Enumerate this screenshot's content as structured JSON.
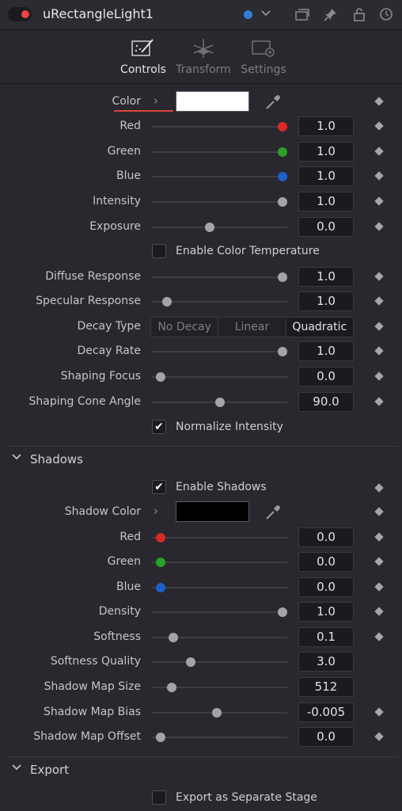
{
  "header": {
    "title": "uRectangleLight1",
    "accent_color": "#2f7fd0",
    "icons": [
      "power-toggle",
      "color-dropdown",
      "versions-icon",
      "pin-icon",
      "lock-icon",
      "reset-icon"
    ]
  },
  "tabs": [
    {
      "label": "Controls",
      "icon": "controls-icon",
      "active": true
    },
    {
      "label": "Transform",
      "icon": "transform-icon",
      "active": false
    },
    {
      "label": "Settings",
      "icon": "settings-icon",
      "active": false
    }
  ],
  "controls": {
    "color_label": "Color",
    "color_value": "#ffffff",
    "red": {
      "label": "Red",
      "value": "1.0",
      "level": 1.0,
      "color": "#d62a2a"
    },
    "green": {
      "label": "Green",
      "value": "1.0",
      "level": 1.0,
      "color": "#2aa02a"
    },
    "blue": {
      "label": "Blue",
      "value": "1.0",
      "level": 1.0,
      "color": "#1e5fc8"
    },
    "intensity": {
      "label": "Intensity",
      "value": "1.0",
      "level": 1.0
    },
    "exposure": {
      "label": "Exposure",
      "value": "0.0",
      "level": 0.42
    },
    "enable_color_temperature": {
      "label": "Enable Color Temperature",
      "checked": false
    },
    "diffuse_response": {
      "label": "Diffuse Response",
      "value": "1.0",
      "level": 1.0
    },
    "specular_response": {
      "label": "Specular Response",
      "value": "1.0",
      "level": 0.08
    },
    "decay_type": {
      "label": "Decay Type",
      "options": [
        "No Decay",
        "Linear",
        "Quadratic"
      ],
      "selected": "Quadratic"
    },
    "decay_rate": {
      "label": "Decay Rate",
      "value": "1.0",
      "level": 1.0
    },
    "shaping_focus": {
      "label": "Shaping Focus",
      "value": "0.0",
      "level": 0.03
    },
    "shaping_cone_angle": {
      "label": "Shaping Cone Angle",
      "value": "90.0",
      "level": 0.5
    },
    "normalize_intensity": {
      "label": "Normalize Intensity",
      "checked": true
    }
  },
  "shadows": {
    "section_title": "Shadows",
    "enable_shadows": {
      "label": "Enable Shadows",
      "checked": true
    },
    "shadow_color_label": "Shadow Color",
    "shadow_color_value": "#000000",
    "red": {
      "label": "Red",
      "value": "0.0",
      "level": 0.03,
      "color": "#d62a2a"
    },
    "green": {
      "label": "Green",
      "value": "0.0",
      "level": 0.03,
      "color": "#2aa02a"
    },
    "blue": {
      "label": "Blue",
      "value": "0.0",
      "level": 0.03,
      "color": "#1e5fc8"
    },
    "density": {
      "label": "Density",
      "value": "1.0",
      "level": 1.0
    },
    "softness": {
      "label": "Softness",
      "value": "0.1",
      "level": 0.13
    },
    "softness_quality": {
      "label": "Softness Quality",
      "value": "3.0",
      "level": 0.27
    },
    "shadow_map_size": {
      "label": "Shadow Map Size",
      "value": "512",
      "level": 0.12
    },
    "shadow_map_bias": {
      "label": "Shadow Map Bias",
      "value": "-0.005",
      "level": 0.48
    },
    "shadow_map_offset": {
      "label": "Shadow Map Offset",
      "value": "0.0",
      "level": 0.03
    }
  },
  "export": {
    "section_title": "Export",
    "export_separate_stage": {
      "label": "Export as Separate Stage",
      "checked": false
    }
  }
}
